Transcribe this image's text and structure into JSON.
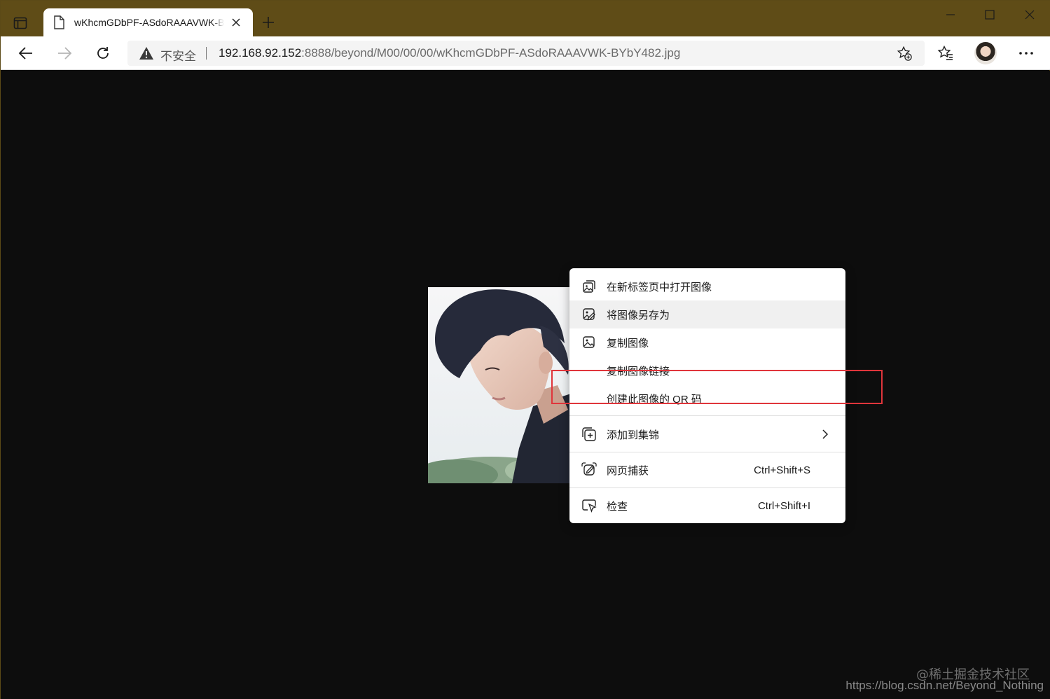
{
  "window": {
    "tab_title": "wKhcmGDbPF-ASdoRAAAVWK-BYbY482.jpg",
    "new_tab_label": "+"
  },
  "address_bar": {
    "security_label": "不安全",
    "url_host": "192.168.92.152",
    "url_rest": ":8888/beyond/M00/00/00/wKhcmGDbPF-ASdoRAAAVWK-BYbY482.jpg"
  },
  "context_menu": {
    "items": [
      {
        "label": "在新标签页中打开图像",
        "icon": "open-in-new-tab-icon"
      },
      {
        "label": "将图像另存为",
        "icon": "save-image-icon"
      },
      {
        "label": "复制图像",
        "icon": "copy-image-icon"
      },
      {
        "label": "复制图像链接",
        "icon": ""
      },
      {
        "label": "创建此图像的 QR 码",
        "icon": ""
      },
      {
        "label": "添加到集锦",
        "icon": "collections-icon"
      },
      {
        "label": "网页捕获",
        "shortcut": "Ctrl+Shift+S",
        "icon": "web-capture-icon"
      },
      {
        "label": "检查",
        "shortcut": "Ctrl+Shift+I",
        "icon": "inspect-icon"
      }
    ]
  },
  "watermark": {
    "line1": "@稀土掘金技术社区",
    "line2": "https://blog.csdn.net/Beyond_Nothing"
  },
  "colors": {
    "titlebar": "#5f4c17",
    "page_bg": "#0d0d0d",
    "highlight": "#e0353b"
  }
}
